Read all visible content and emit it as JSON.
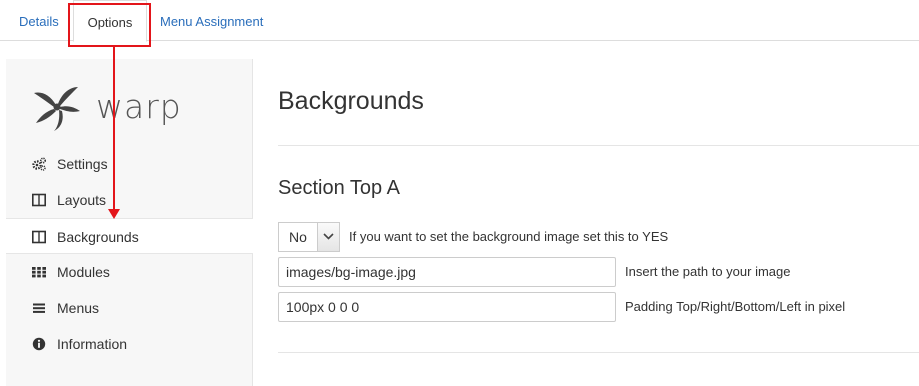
{
  "tabs": [
    {
      "label": "Details"
    },
    {
      "label": "Options"
    },
    {
      "label": "Menu Assignment"
    }
  ],
  "sidebar": {
    "logo_text": "warp",
    "items": [
      {
        "label": "Settings",
        "icon": "cogs-icon"
      },
      {
        "label": "Layouts",
        "icon": "columns-icon"
      },
      {
        "label": "Backgrounds",
        "icon": "columns-icon",
        "active": true
      },
      {
        "label": "Modules",
        "icon": "grid-icon"
      },
      {
        "label": "Menus",
        "icon": "bars-icon"
      },
      {
        "label": "Information",
        "icon": "info-circle-icon"
      }
    ]
  },
  "main": {
    "title": "Backgrounds",
    "section_title": "Section Top A",
    "bg_select": {
      "value": "No",
      "help": "If you want to set the background image set this to YES"
    },
    "image_path": {
      "value": "images/bg-image.jpg",
      "help": "Insert the path to your image"
    },
    "padding": {
      "value": "100px 0 0 0",
      "help": "Padding Top/Right/Bottom/Left in pixel"
    }
  },
  "colors": {
    "link": "#2a6ebb",
    "annotation": "#e3151a",
    "sidebar_bg": "#f7f7f7"
  }
}
